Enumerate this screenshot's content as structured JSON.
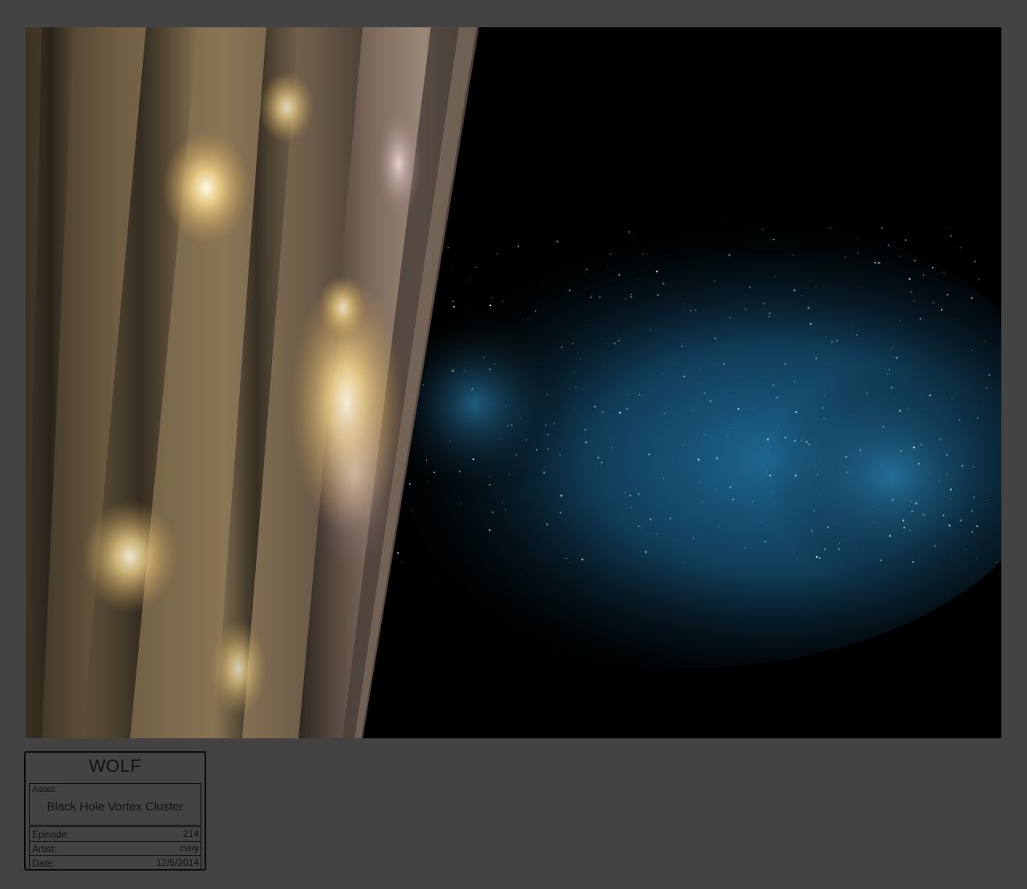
{
  "title_block": {
    "project": "WOLF",
    "asset_label": "Asset:",
    "asset_value": "Black Hole Vortex Cluster",
    "episode_label": "Episode:",
    "episode_value": "214",
    "artist_label": "Artist:",
    "artist_value": "cvoy",
    "date_label": "Date:",
    "date_value": "12/5/2014"
  },
  "colors": {
    "page_background": "#434343",
    "space": "#000000",
    "nebula": "#1e6a96",
    "vortex_gold": "#b89a6a",
    "vortex_glow": "#fff2c8"
  }
}
